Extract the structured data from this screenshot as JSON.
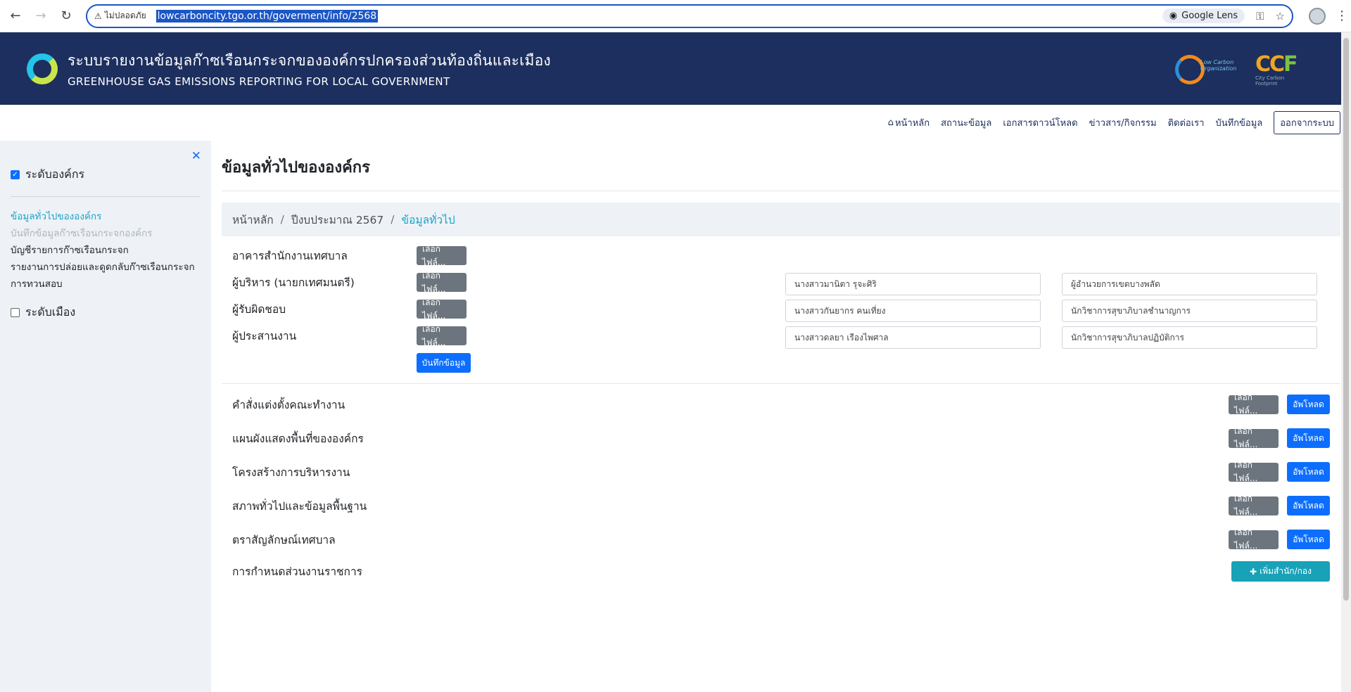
{
  "browser": {
    "security_label": "ไม่ปลอดภัย",
    "url": "lowcarboncity.tgo.or.th/goverment/info/2568",
    "lens_label": "Google Lens"
  },
  "banner": {
    "title_th": "ระบบรายงานข้อมูลก๊าซเรือนกระจกขององค์กรปกครองส่วนท้องถิ่นและเมือง",
    "title_en": "GREENHOUSE GAS EMISSIONS REPORTING FOR LOCAL GOVERNMENT",
    "badge1_text": "Low Carbon Organization",
    "badge2_c1": "CC",
    "badge2_c2": "F",
    "badge2_sub": "City Carbon Footprint"
  },
  "topnav": {
    "home": "หน้าหลัก",
    "status": "สถานะข้อมูล",
    "downloads": "เอกสารดาวน์โหลด",
    "news": "ข่าวสาร/กิจกรรม",
    "contact": "ติดต่อเรา",
    "record": "บันทึกข้อมูล",
    "logout": "ออกจากระบบ"
  },
  "sidebar": {
    "org_level": "ระดับองค์กร",
    "items": [
      "ข้อมูลทั่วไปขององค์กร",
      "บันทึกข้อมูลก๊าซเรือนกระจกองค์กร",
      "บัญชีรายการก๊าซเรือนกระจก",
      "รายงานการปล่อยและดูดกลับก๊าซเรือนกระจก",
      "การทวนสอบ"
    ],
    "city_level": "ระดับเมือง"
  },
  "main": {
    "title": "ข้อมูลทั่วไปขององค์กร",
    "breadcrumb": [
      "หน้าหลัก",
      "ปีงบประมาณ 2567",
      "ข้อมูลทั่วไป"
    ],
    "choose_file": "เลือกไฟล์...",
    "save": "บันทึกข้อมูล",
    "form_rows": [
      {
        "label": "อาคารสำนักงานเทศบาล"
      },
      {
        "label": "ผู้บริหาร (นายกเทศมนตรี)",
        "name": "นางสาวมานิตา รุจะศิริ",
        "position": "ผู้อำนวยการเขตบางพลัด"
      },
      {
        "label": "ผู้รับผิดชอบ",
        "name": "นางสาวกันยากร คนเที่ยง",
        "position": "นักวิชาการสุขาภิบาลชำนาญการ"
      },
      {
        "label": "ผู้ประสานงาน",
        "name": "นางสาวดลยา เรืองไพศาล",
        "position": "นักวิชาการสุขาภิบาลปฏิบัติการ"
      }
    ],
    "documents": [
      "คำสั่งแต่งตั้งคณะทำงาน",
      "แผนผังแสดงพื้นที่ขององค์กร",
      "โครงสร้างการบริหารงาน",
      "สภาพทั่วไปและข้อมูลพื้นฐาน",
      "ตราสัญลักษณ์เทศบาล"
    ],
    "upload": "อัพโหลด",
    "gov_units_label": "การกำหนดส่วนงานราชการ",
    "add_unit": "เพิ่มสำนัก/กอง"
  }
}
